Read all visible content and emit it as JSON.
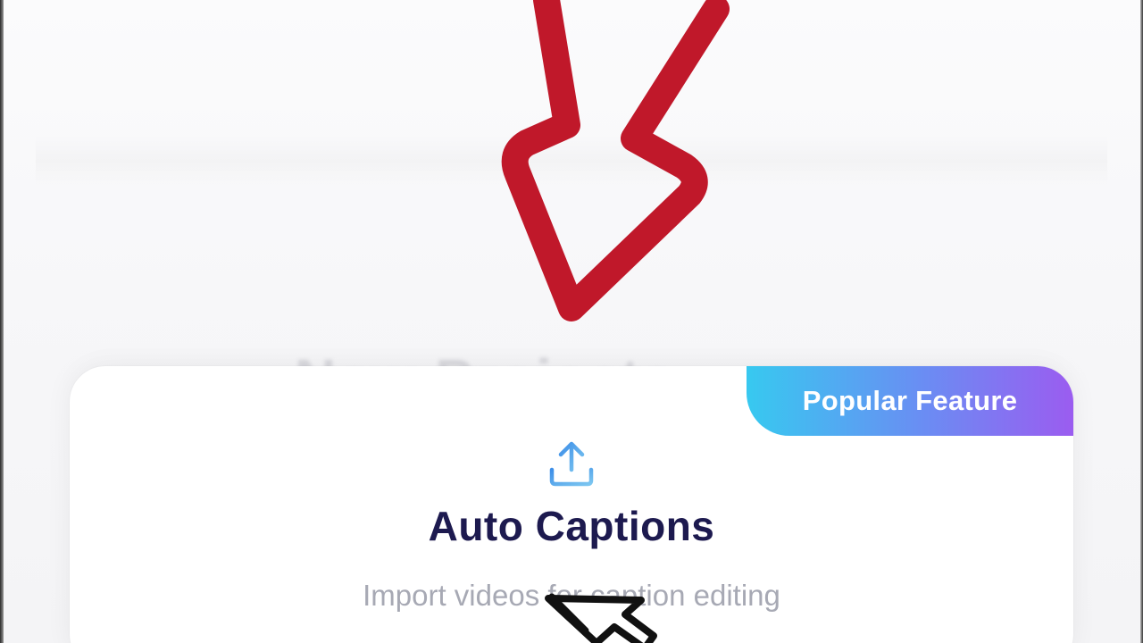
{
  "feature_card": {
    "badge": "Popular Feature",
    "icon": "upload-icon",
    "title": "Auto Captions",
    "subtitle": "Import videos for caption editing"
  },
  "annotation": {
    "icon": "red-arrow-icon",
    "color": "#c0182a"
  },
  "colors": {
    "title": "#1d1a4f",
    "subtitle": "#a7a9b4",
    "badge_gradient_start": "#37c9f0",
    "badge_gradient_end": "#9b5cf0",
    "icon_accent": "#3e8fe8"
  }
}
